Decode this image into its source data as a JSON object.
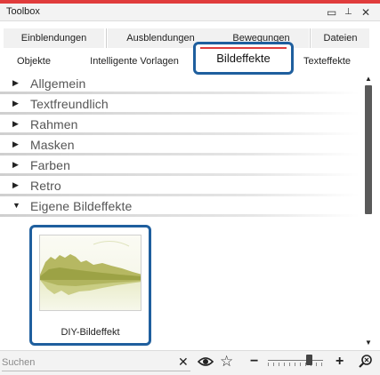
{
  "window": {
    "title": "Toolbox",
    "controls": {
      "restore": "▭",
      "pin": "⊥",
      "close": "✕"
    },
    "accent_color": "#e03c3c",
    "highlight_color": "#1f5f9e"
  },
  "tabs": {
    "row1": [
      "Einblendungen",
      "Ausblendungen",
      "Bewegungen",
      "Dateien"
    ],
    "row2": [
      "Objekte",
      "Intelligente Vorlagen",
      "Bildeffekte",
      "Texteffekte"
    ],
    "active": "Bildeffekte"
  },
  "categories": [
    {
      "label": "Allgemein",
      "expanded": false,
      "icon": "triangle-right-icon"
    },
    {
      "label": "Textfreundlich",
      "expanded": false,
      "icon": "triangle-right-icon"
    },
    {
      "label": "Rahmen",
      "expanded": false,
      "icon": "triangle-right-icon"
    },
    {
      "label": "Masken",
      "expanded": false,
      "icon": "triangle-right-icon"
    },
    {
      "label": "Farben",
      "expanded": false,
      "icon": "triangle-right-icon"
    },
    {
      "label": "Retro",
      "expanded": false,
      "icon": "triangle-right-icon"
    },
    {
      "label": "Eigene Bildeffekte",
      "expanded": true,
      "icon": "triangle-down-icon"
    }
  ],
  "effects": [
    {
      "label": "DIY-Bildeffekt",
      "thumbnail": "landscape-thumbnail"
    }
  ],
  "glyphs": {
    "collapsed": "▶",
    "expanded": "▼",
    "scroll_up": "▲",
    "scroll_down": "▼"
  },
  "bottom": {
    "search_placeholder": "Suchen",
    "clear_icon": "✕",
    "eye_icon": "👁",
    "star_icon": "☆",
    "zoom_out": "−",
    "zoom_in": "+",
    "search_icon": "🔍",
    "zoom_level": 0.78
  }
}
